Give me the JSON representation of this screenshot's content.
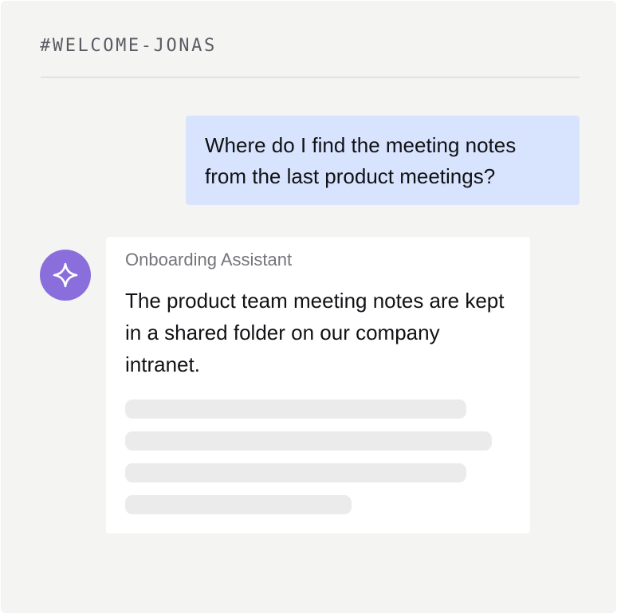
{
  "channel": {
    "name": "#WELCOME-JONAS"
  },
  "messages": {
    "user": {
      "text": "Where do I find the meeting notes from the last product meetings?"
    },
    "assistant": {
      "name": "Onboarding Assistant",
      "text": "The product team meeting notes are kept in a shared folder on our company intranet.",
      "avatar_icon": "sparkle-icon",
      "avatar_color": "#8a6fdc",
      "loading_lines": 4
    }
  },
  "colors": {
    "user_bubble": "#d8e3fd",
    "background": "#f4f4f3",
    "card": "#ffffff",
    "skeleton": "#ebebeb"
  }
}
